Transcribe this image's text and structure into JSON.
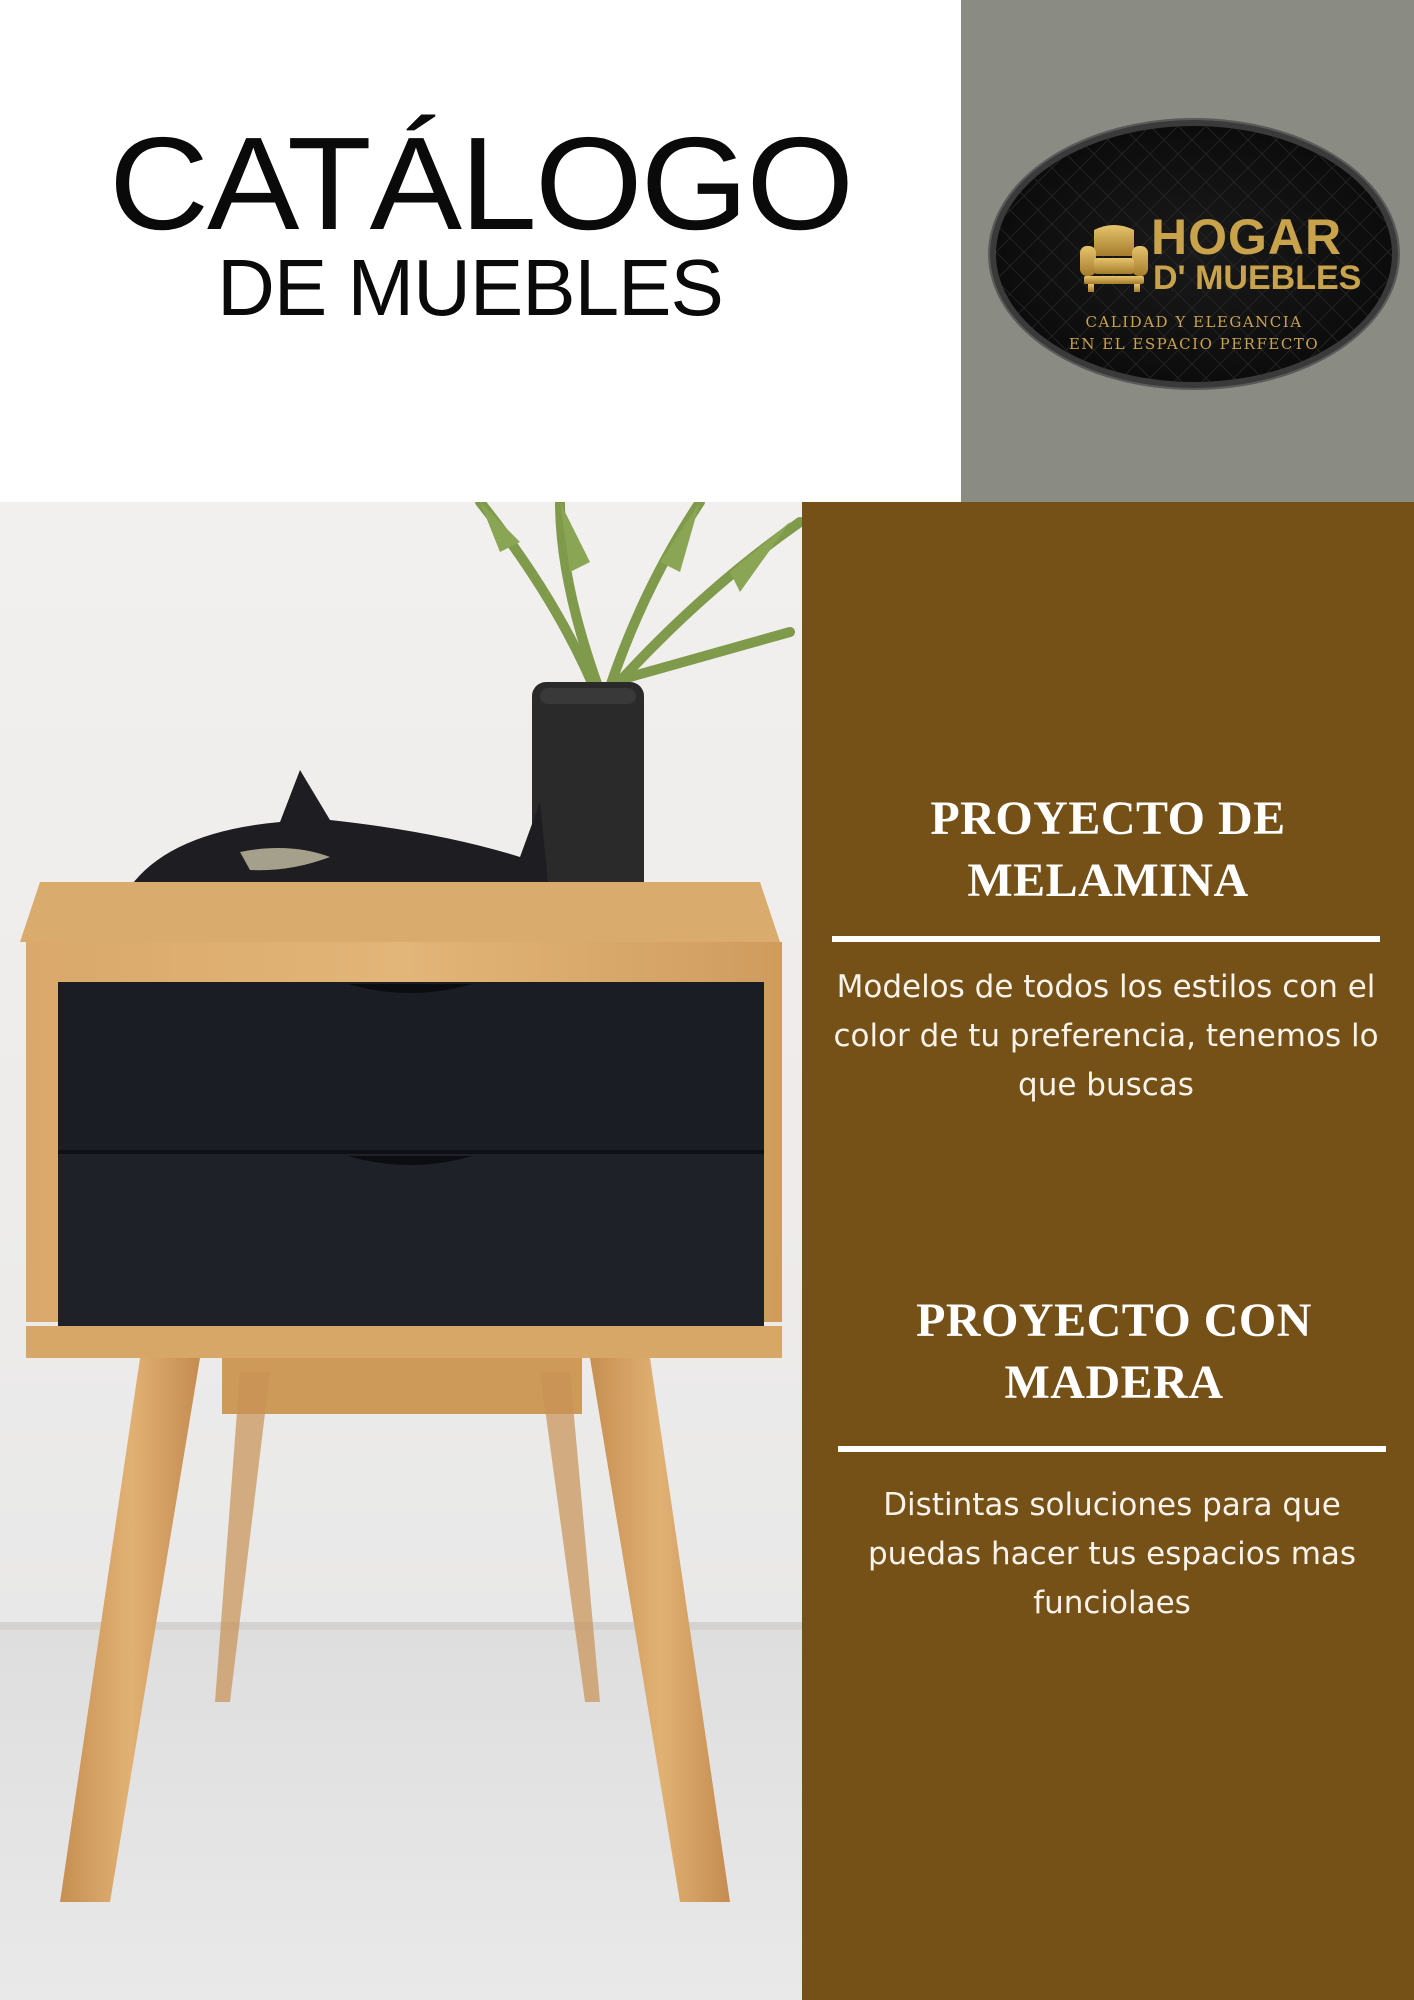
{
  "header": {
    "title": "CATÁLOGO",
    "subtitle": "DE MUEBLES"
  },
  "logo": {
    "brand_line1": "HOGAR",
    "brand_line2": "D' MUEBLES",
    "tagline_line1": "CALIDAD Y ELEGANCIA",
    "tagline_line2": "EN EL ESPACIO PERFECTO",
    "icon": "armchair-icon",
    "colors": {
      "gold": "#c9a24c",
      "background": "#0c0c0c"
    }
  },
  "photo": {
    "subject": "nightstand-with-plant-and-fish-sculpture"
  },
  "sections": [
    {
      "title": "PROYECTO DE MELAMINA",
      "body": "Modelos de todos los estilos con el color de tu preferencia, tenemos lo que buscas"
    },
    {
      "title": "PROYECTO CON MADERA",
      "body": "Distintas soluciones para que puedas hacer tus espacios mas funciolaes"
    }
  ],
  "colors": {
    "panel": "#755117",
    "header_right": "#8a8c84",
    "text_light": "#ffffff"
  }
}
